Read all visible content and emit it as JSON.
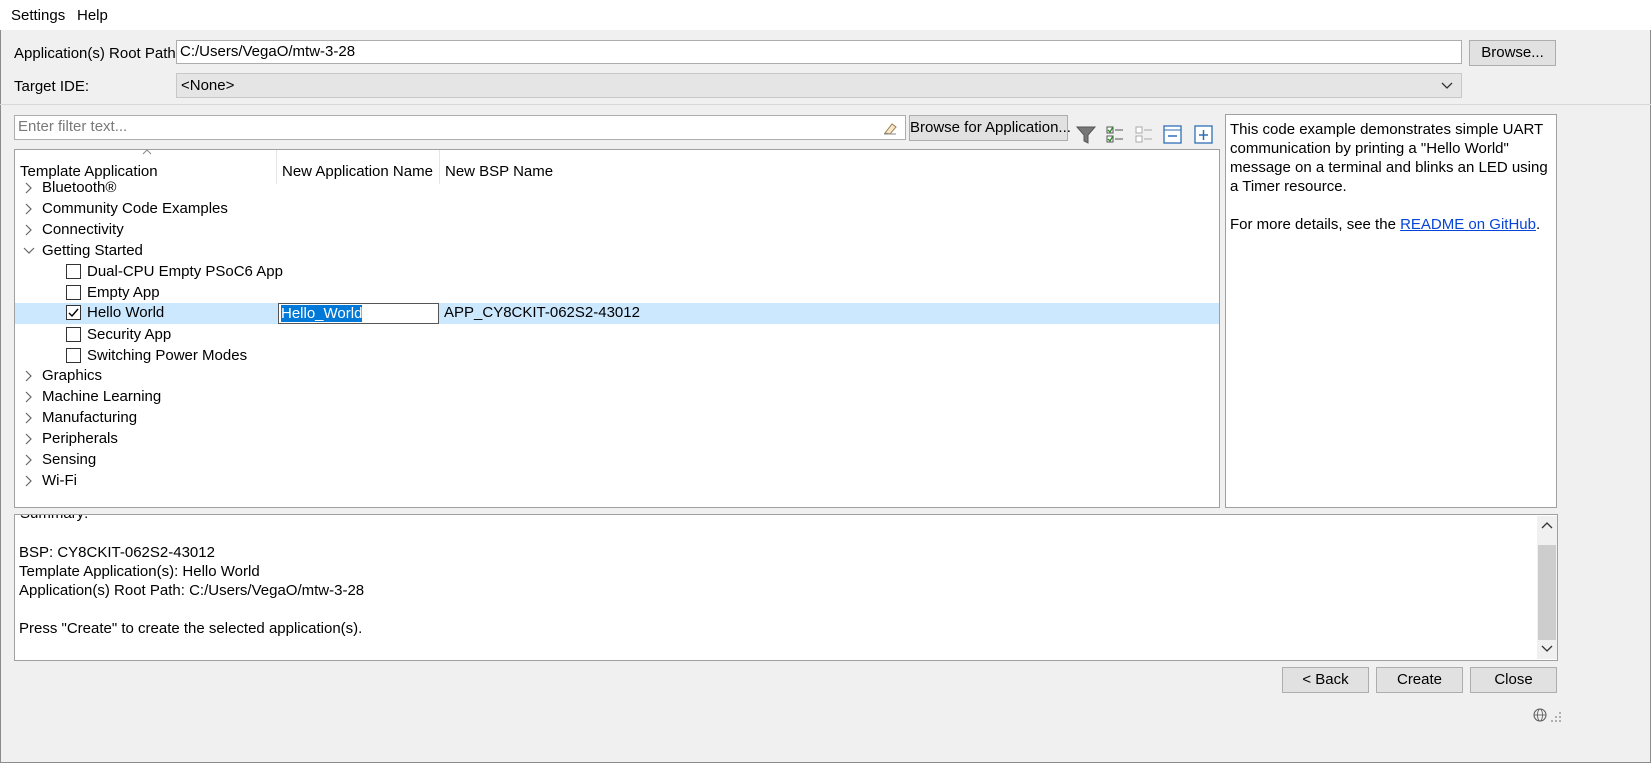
{
  "menu": {
    "settings": "Settings",
    "help": "Help"
  },
  "root_path": {
    "label": "Application(s) Root Path:",
    "value": "C:/Users/VegaO/mtw-3-28",
    "browse": "Browse..."
  },
  "target_ide": {
    "label": "Target IDE:",
    "value": "<None>"
  },
  "filter": {
    "placeholder": "Enter filter text...",
    "browse_apps": "Browse for Application..."
  },
  "table": {
    "headers": {
      "template": "Template Application",
      "app_name": "New Application Name",
      "bsp_name": "New BSP Name"
    },
    "categories": {
      "bluetooth": "Bluetooth®",
      "community": "Community Code Examples",
      "connectivity": "Connectivity",
      "getting_started": "Getting Started",
      "graphics": "Graphics",
      "machine_learning": "Machine Learning",
      "manufacturing": "Manufacturing",
      "peripherals": "Peripherals",
      "sensing": "Sensing",
      "wifi": "Wi-Fi"
    },
    "apps": {
      "dual_cpu": "Dual-CPU Empty PSoC6 App",
      "empty": "Empty App",
      "hello_world": "Hello World",
      "security": "Security App",
      "switching": "Switching Power Modes"
    },
    "selected_row": {
      "app_name": "Hello_World",
      "bsp_name": "APP_CY8CKIT-062S2-43012"
    }
  },
  "description": {
    "line1": "This code example demonstrates simple UART communication by printing a \"Hello World\" message on a terminal and blinks an LED using a Timer resource.",
    "more_prefix": "For more details, see the ",
    "link": "README on GitHub",
    "more_suffix": "."
  },
  "summary": {
    "heading": "Summary:",
    "bsp": "BSP: CY8CKIT-062S2-43012",
    "templates": "Template Application(s): Hello World",
    "root": "Application(s) Root Path: C:/Users/VegaO/mtw-3-28",
    "press": "Press \"Create\" to create the selected application(s)."
  },
  "buttons": {
    "back": "< Back",
    "create": "Create",
    "close": "Close"
  }
}
